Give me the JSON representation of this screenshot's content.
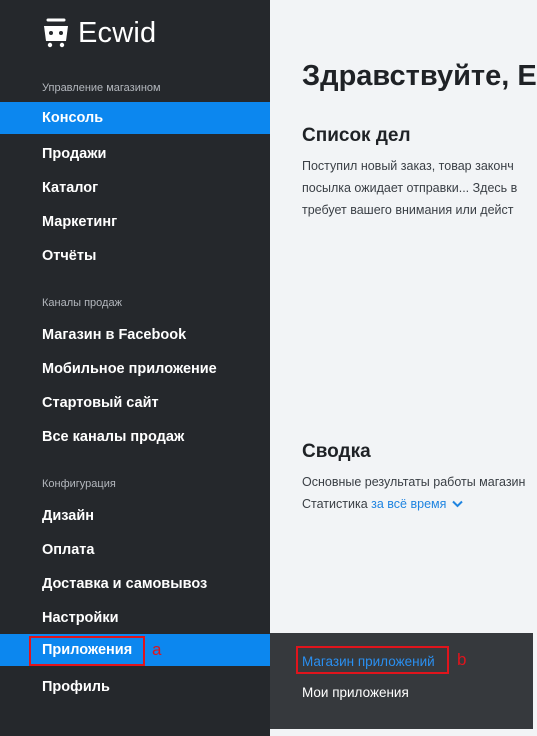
{
  "brand": {
    "name": "Ecwid",
    "icon": "cart-logo-icon"
  },
  "sidebar": {
    "sections": [
      {
        "label": "Управление магазином",
        "items": [
          {
            "label": "Консоль",
            "active": true
          },
          {
            "label": "Продажи"
          },
          {
            "label": "Каталог"
          },
          {
            "label": "Маркетинг"
          },
          {
            "label": "Отчёты"
          }
        ]
      },
      {
        "label": "Каналы продаж",
        "items": [
          {
            "label": "Магазин в Facebook"
          },
          {
            "label": "Мобильное приложение"
          },
          {
            "label": "Стартовый сайт"
          },
          {
            "label": "Все каналы продаж"
          }
        ]
      },
      {
        "label": "Конфигурация",
        "items": [
          {
            "label": "Дизайн"
          },
          {
            "label": "Оплата"
          },
          {
            "label": "Доставка и самовывоз"
          },
          {
            "label": "Настройки"
          },
          {
            "label": "Приложения",
            "highlighted": true
          },
          {
            "label": "Профиль"
          }
        ]
      }
    ]
  },
  "main": {
    "greeting": "Здравствуйте, Е",
    "todo": {
      "title": "Список дел",
      "lines": [
        "Поступил новый заказ, товар законч",
        "посылка ожидает отправки... Здесь в",
        "требует вашего внимания или дейст"
      ]
    },
    "summary": {
      "title": "Сводка",
      "line1": "Основные результаты работы магазин",
      "stat_prefix": "Статистика",
      "period_link": "за всё время",
      "dropdown_icon": "chevron-down-icon"
    }
  },
  "submenu": {
    "items": [
      {
        "label": "Магазин приложений"
      },
      {
        "label": "Мои приложения"
      }
    ]
  },
  "annotations": {
    "a": "a",
    "b": "b"
  },
  "colors": {
    "sidebar_bg": "#25282c",
    "accent": "#0c87ef",
    "link": "#1f84e0",
    "annotation": "#e0141c"
  }
}
